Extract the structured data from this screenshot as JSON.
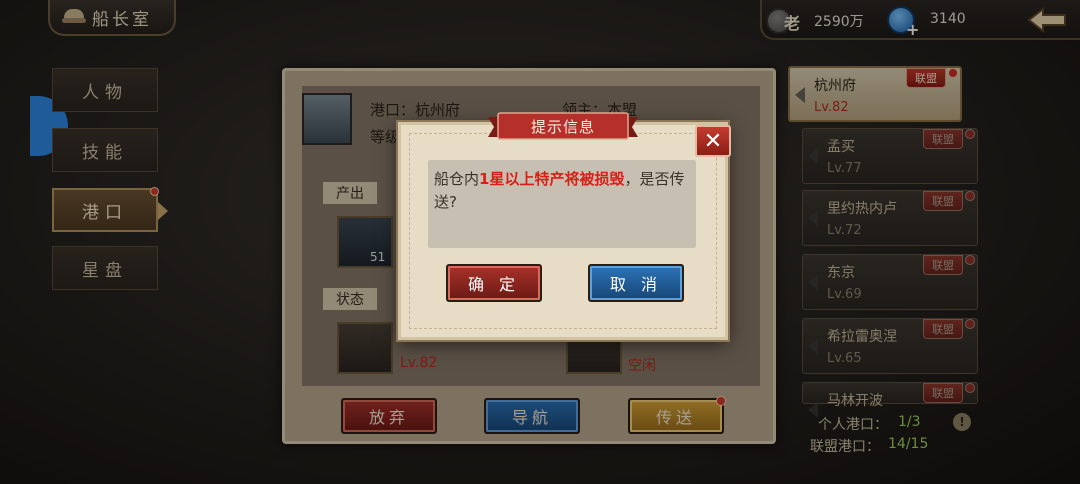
{
  "header": {
    "title": "船长室",
    "currency_label": "老",
    "silver_value": "2590万",
    "gem_value": "3140"
  },
  "nav": [
    {
      "label": "人物",
      "active": false
    },
    {
      "label": "技能",
      "active": false
    },
    {
      "label": "港口",
      "active": true,
      "badge": true
    },
    {
      "label": "星盘",
      "active": false
    }
  ],
  "panel": {
    "port_label": "港口：杭州府",
    "lord_label": "领主：本盟",
    "level_label": "等级",
    "product_section": "产出",
    "product_count": "51",
    "status_section": "状态",
    "status_left": "Lv.82",
    "status_right": "空闲",
    "btn_abandon": "放弃",
    "btn_navigate": "导航",
    "btn_teleport": "传送"
  },
  "ports": [
    {
      "name": "杭州府",
      "level": "Lv.82",
      "badge": "联盟",
      "selected": true
    },
    {
      "name": "孟买",
      "level": "Lv.77",
      "badge": "联盟",
      "selected": false
    },
    {
      "name": "里约热内卢",
      "level": "Lv.72",
      "badge": "联盟",
      "selected": false
    },
    {
      "name": "东京",
      "level": "Lv.69",
      "badge": "联盟",
      "selected": false
    },
    {
      "name": "希拉雷奥涅",
      "level": "Lv.65",
      "badge": "联盟",
      "selected": false
    },
    {
      "name": "马林开波",
      "level": "",
      "badge": "联盟",
      "selected": false
    }
  ],
  "stats": {
    "personal_label": "个人港口：",
    "personal_value": "1/3",
    "alliance_label": "联盟港口：",
    "alliance_value": "14/15",
    "info_icon": "!"
  },
  "modal": {
    "title": "提示信息",
    "message_prefix": "船仓内",
    "message_highlight": "1星以上特产将被损毁",
    "message_suffix": "，是否传送?",
    "confirm": "确 定",
    "cancel": "取 消",
    "close": "✕"
  }
}
